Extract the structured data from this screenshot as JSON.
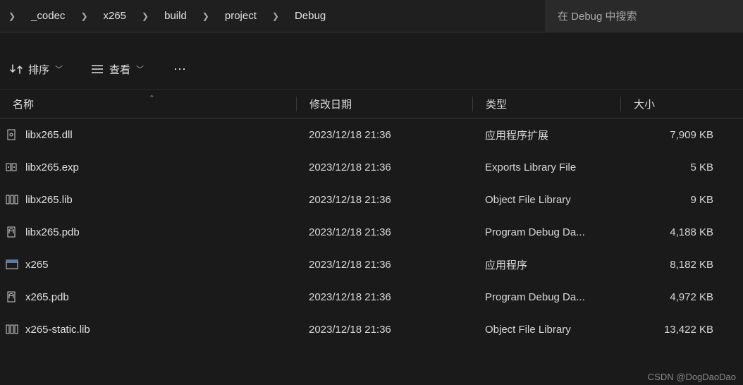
{
  "breadcrumb": {
    "items": [
      "_codec",
      "x265",
      "build",
      "project",
      "Debug"
    ]
  },
  "search": {
    "placeholder": "在 Debug 中搜索"
  },
  "toolbar": {
    "sort_label": "排序",
    "view_label": "查看"
  },
  "columns": {
    "name": "名称",
    "date": "修改日期",
    "type": "类型",
    "size": "大小"
  },
  "files": [
    {
      "icon": "dll",
      "name": "libx265.dll",
      "date": "2023/12/18 21:36",
      "type": "应用程序扩展",
      "size": "7,909 KB"
    },
    {
      "icon": "exp",
      "name": "libx265.exp",
      "date": "2023/12/18 21:36",
      "type": "Exports Library File",
      "size": "5 KB"
    },
    {
      "icon": "lib",
      "name": "libx265.lib",
      "date": "2023/12/18 21:36",
      "type": "Object File Library",
      "size": "9 KB"
    },
    {
      "icon": "pdb",
      "name": "libx265.pdb",
      "date": "2023/12/18 21:36",
      "type": "Program Debug Da...",
      "size": "4,188 KB"
    },
    {
      "icon": "exe",
      "name": "x265",
      "date": "2023/12/18 21:36",
      "type": "应用程序",
      "size": "8,182 KB"
    },
    {
      "icon": "pdb",
      "name": "x265.pdb",
      "date": "2023/12/18 21:36",
      "type": "Program Debug Da...",
      "size": "4,972 KB"
    },
    {
      "icon": "lib",
      "name": "x265-static.lib",
      "date": "2023/12/18 21:36",
      "type": "Object File Library",
      "size": "13,422 KB"
    }
  ],
  "watermark": "CSDN @DogDaoDao"
}
